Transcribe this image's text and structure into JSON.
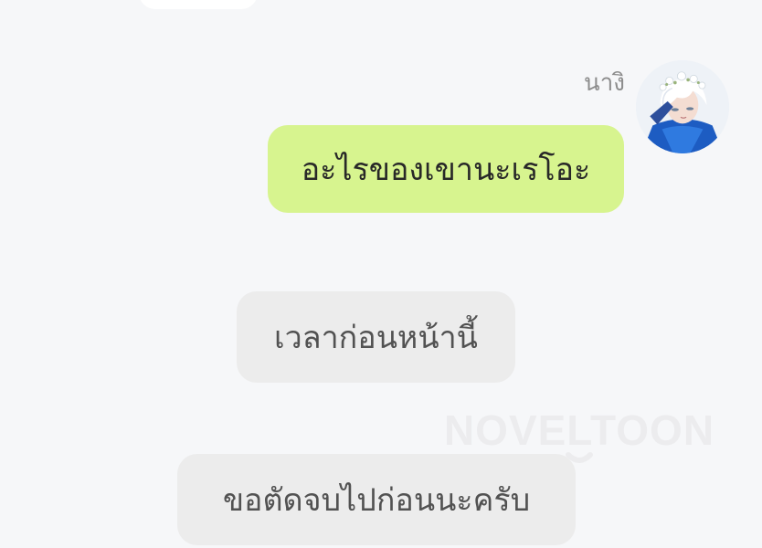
{
  "chat": {
    "sender_name": "นางิ",
    "messages": [
      {
        "type": "outgoing",
        "text": "อะไรของเขานะเรโอะ"
      },
      {
        "type": "system",
        "text": "เวลาก่อนหน้านี้"
      },
      {
        "type": "system",
        "text": "ขอตัดจบไปก่อนนะครับ"
      }
    ]
  },
  "watermark": {
    "text": "NOVELTOON"
  },
  "colors": {
    "background": "#f6f7f9",
    "outgoing_bubble": "#d7f48f",
    "system_bubble": "#ececec",
    "sender_name": "#8d8d8d"
  }
}
